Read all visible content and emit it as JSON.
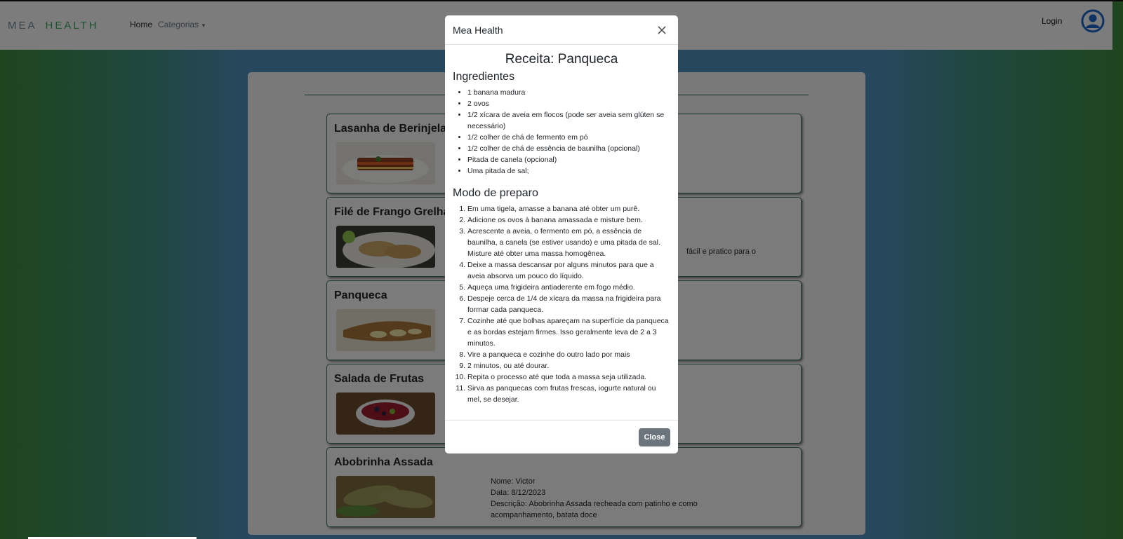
{
  "navbar": {
    "brand_part1": "MEA",
    "brand_part2": "HEALTH",
    "home": "Home",
    "categories": "Categorias",
    "login": "Login",
    "icons": {
      "user": "user-circle-icon",
      "caret": "caret-down-icon"
    },
    "colors": {
      "brand_blue": "#6c8a9a",
      "brand_green": "#3aa65a",
      "user_icon": "#1c64c8"
    }
  },
  "recipes": [
    {
      "title": "Lasanha de Berinjela"
    },
    {
      "title": "Filé de Frango Grelha",
      "description_fragment": "fácil e pratico para o"
    },
    {
      "title": "Panqueca"
    },
    {
      "title": "Salada de Frutas"
    },
    {
      "title": "Abobrinha Assada",
      "name_line": "Nome: Victor",
      "date_line": "Data: 8/12/2023",
      "description_line": "Descrição: Abobrinha Assada recheada com patinho e como acompanhamento, batata doce"
    }
  ],
  "modal": {
    "title": "Mea Health",
    "recipe_title": "Receita: Panqueca",
    "ingredients_heading": "Ingredientes",
    "ingredients": [
      "1 banana madura",
      "2 ovos",
      "1/2 xícara de aveia em flocos (pode ser aveia sem glúten se necessário)",
      "1/2 colher de chá de fermento em pó",
      "1/2 colher de chá de essência de baunilha (opcional)",
      "Pitada de canela (opcional)",
      "Uma pitada de sal;"
    ],
    "steps_heading": "Modo de preparo",
    "steps": [
      "Em uma tigela, amasse a banana até obter um purê.",
      "Adicione os ovos à banana amassada e misture bem.",
      "Acrescente a aveia, o fermento em pó, a essência de baunilha, a canela (se estiver usando) e uma pitada de sal. Misture até obter uma massa homogênea.",
      "Deixe a massa descansar por alguns minutos para que a aveia absorva um pouco do líquido.",
      "Aqueça uma frigideira antiaderente em fogo médio.",
      "Despeje cerca de 1/4 de xícara da massa na frigideira para formar cada panqueca.",
      "Cozinhe até que bolhas apareçam na superfície da panqueca e as bordas estejam firmes. Isso geralmente leva de 2 a 3 minutos.",
      "Vire a panqueca e cozinhe do outro lado por mais",
      "2 minutos, ou até dourar.",
      "Repita o processo até que toda a massa seja utilizada.",
      "Sirva as panquecas com frutas frescas, iogurte natural ou mel, se desejar."
    ],
    "close_label": "Close",
    "icons": {
      "close": "close-icon"
    },
    "colors": {
      "close_button": "#6c757d"
    }
  }
}
